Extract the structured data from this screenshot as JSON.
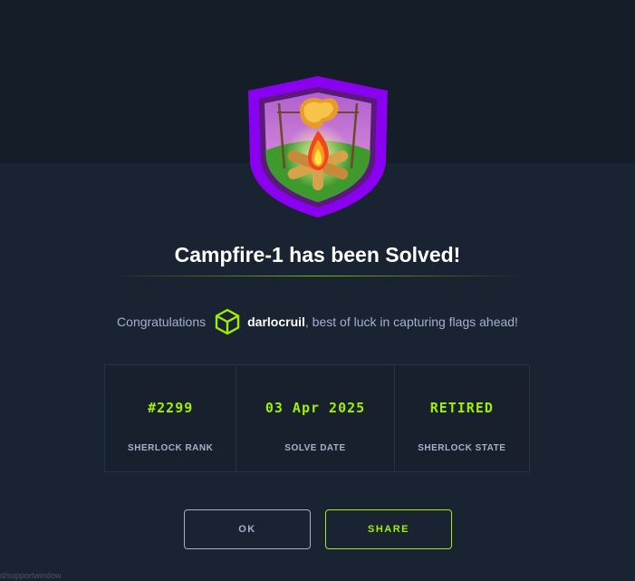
{
  "modal": {
    "title": "Campfire-1 has been Solved!",
    "congrats_prefix": "Congratulations",
    "username": "darlocruil",
    "congrats_suffix": ", best of luck in capturing flags ahead!",
    "badge_icon": "campfire-badge-icon",
    "user_icon": "hackthebox-cube-icon"
  },
  "stats": [
    {
      "value": "#2299",
      "label": "SHERLOCK RANK"
    },
    {
      "value": "03 Apr 2025",
      "label": "SOLVE DATE"
    },
    {
      "value": "RETIRED",
      "label": "SHERLOCK STATE"
    }
  ],
  "buttons": {
    "ok": "OK",
    "share": "SHARE"
  },
  "footer_text": "d/supportwindow",
  "colors": {
    "accent_green": "#9fef00",
    "badge_purple": "#9b00ff",
    "background": "#1a2332",
    "muted_text": "#a4b1cd"
  }
}
